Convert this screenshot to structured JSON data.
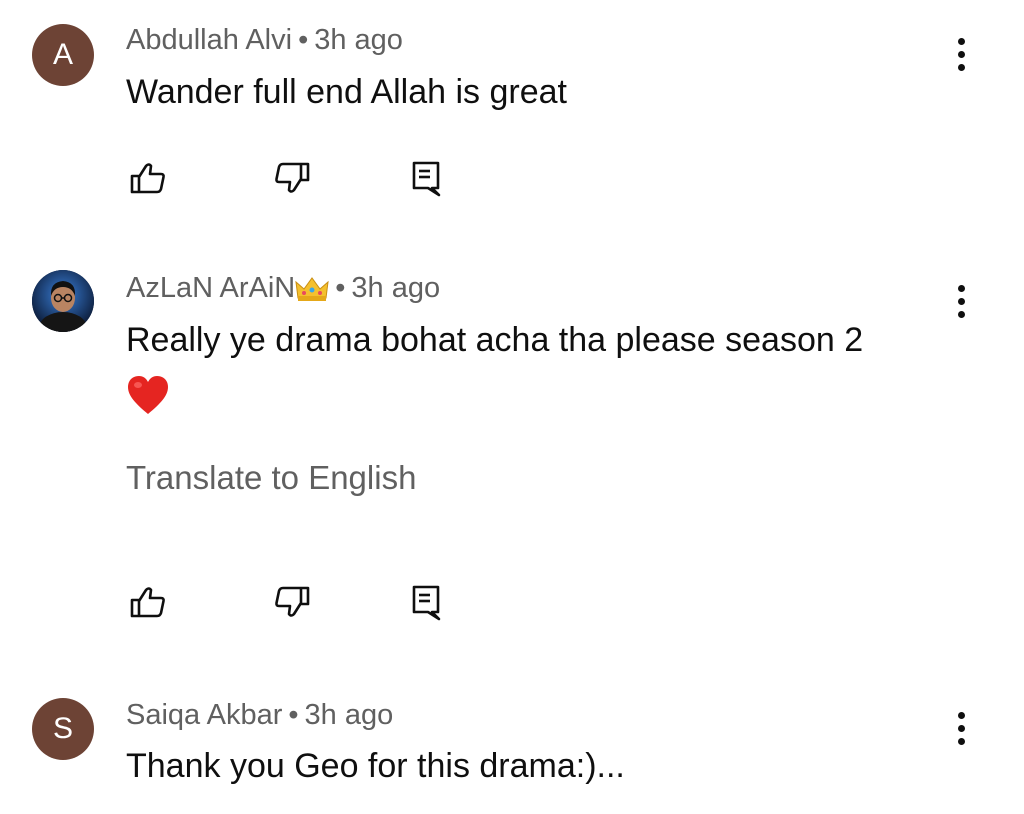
{
  "comments": [
    {
      "avatar_letter": "A",
      "avatar_color": "#6d4335",
      "author": "Abdullah Alvi",
      "separator": "•",
      "time": "3h ago",
      "text": "Wander full end Allah is great"
    },
    {
      "avatar_letter": "",
      "avatar_type": "photo",
      "author": "AzLaN ArAiN",
      "author_badge": "crown-emoji",
      "separator": "•",
      "time": "3h ago",
      "text": "Really ye drama bohat acha tha please season 2",
      "text_emoji": "red-heart-emoji",
      "translate_label": "Translate to English"
    },
    {
      "avatar_letter": "S",
      "avatar_color": "#6d4335",
      "author": "Saiqa Akbar",
      "separator": "•",
      "time": "3h ago",
      "text": "Thank you Geo for this drama:)..."
    }
  ],
  "icons": {
    "like": "thumbs-up-icon",
    "dislike": "thumbs-down-icon",
    "reply": "reply-comment-icon",
    "more": "more-vertical-icon"
  }
}
